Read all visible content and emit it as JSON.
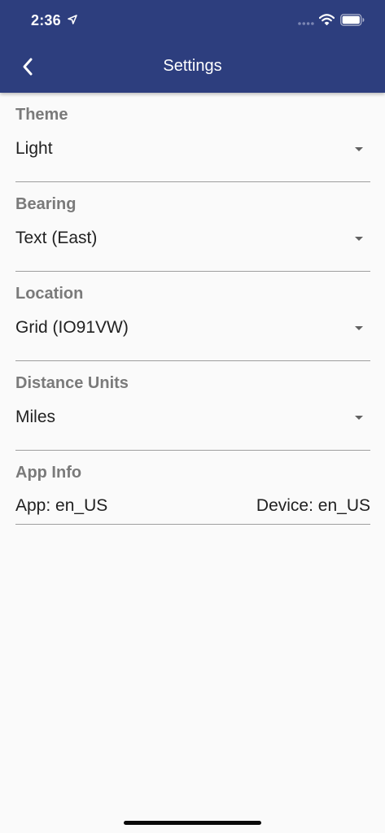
{
  "status_bar": {
    "time": "2:36",
    "icons": [
      "location-arrow-icon",
      "cellular-signal-icon",
      "wifi-icon",
      "battery-icon"
    ]
  },
  "header": {
    "title": "Settings",
    "back_icon": "chevron-left-icon"
  },
  "settings": [
    {
      "label": "Theme",
      "value": "Light"
    },
    {
      "label": "Bearing",
      "value": "Text (East)"
    },
    {
      "label": "Location",
      "value": "Grid (IO91VW)"
    },
    {
      "label": "Distance Units",
      "value": "Miles"
    }
  ],
  "app_info": {
    "label": "App Info",
    "app": "App: en_US",
    "device": "Device: en_US"
  },
  "colors": {
    "header_background": "#2d3e7e",
    "page_background": "#fafafa",
    "label_text": "#7a7a7a",
    "value_text": "#212121",
    "divider": "#9e9e9e"
  }
}
